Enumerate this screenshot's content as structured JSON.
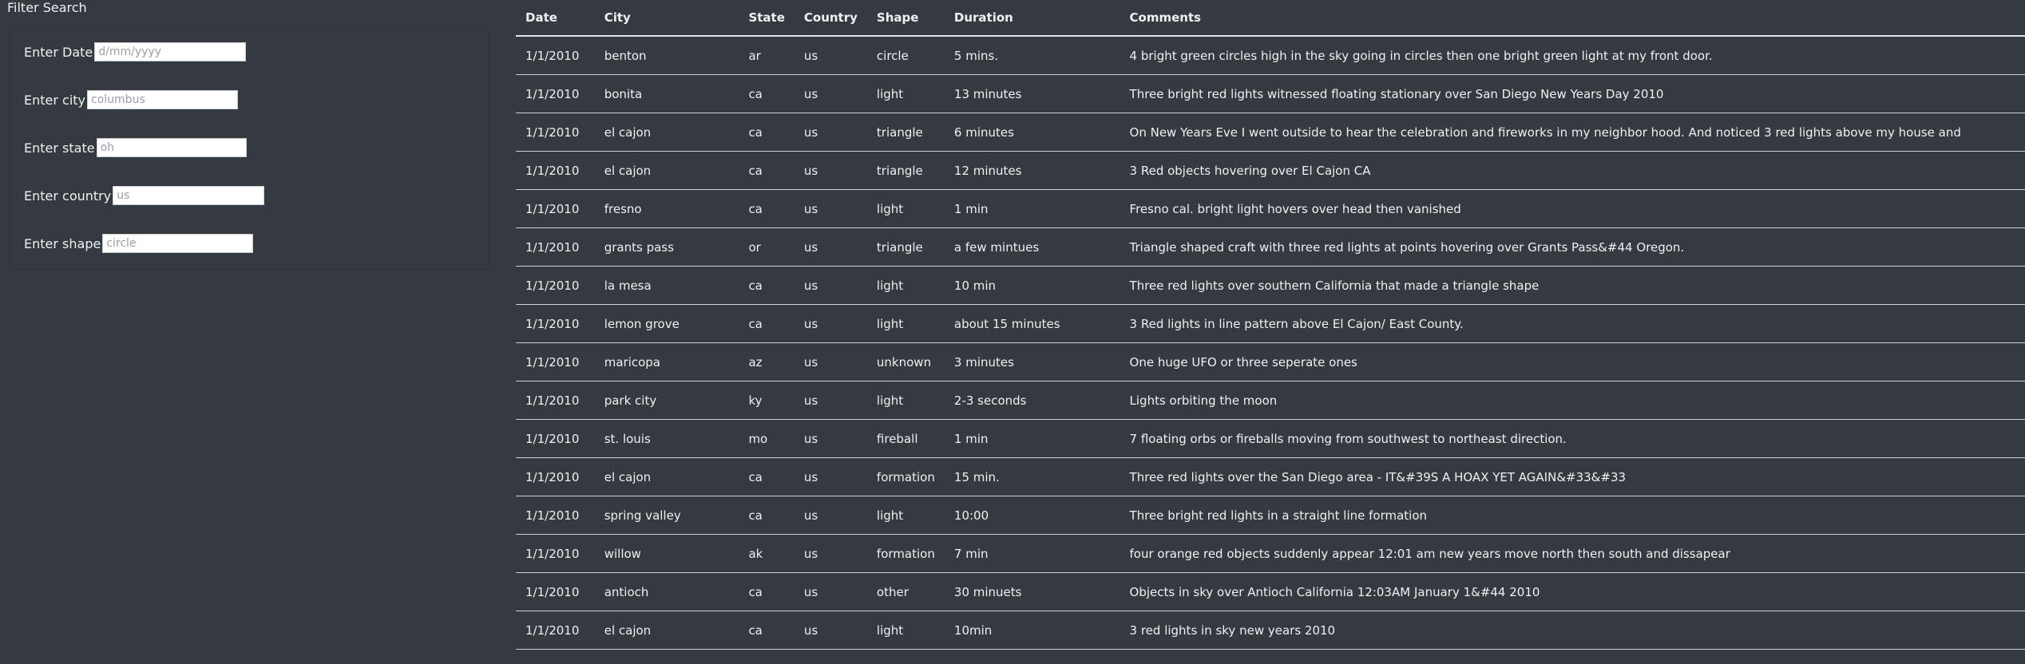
{
  "filter": {
    "title": "Filter Search",
    "fields": [
      {
        "label": "Enter Date",
        "placeholder": "d/mm/yyyy",
        "value": ""
      },
      {
        "label": "Enter city",
        "placeholder": "columbus",
        "value": ""
      },
      {
        "label": "Enter state",
        "placeholder": "oh",
        "value": ""
      },
      {
        "label": "Enter country",
        "placeholder": "us",
        "value": ""
      },
      {
        "label": "Enter shape",
        "placeholder": "circle",
        "value": ""
      }
    ]
  },
  "table": {
    "columns": [
      "Date",
      "City",
      "State",
      "Country",
      "Shape",
      "Duration",
      "Comments"
    ],
    "rows": [
      [
        "1/1/2010",
        "benton",
        "ar",
        "us",
        "circle",
        "5 mins.",
        "4 bright green circles high in the sky going in circles then one bright green light at my front door."
      ],
      [
        "1/1/2010",
        "bonita",
        "ca",
        "us",
        "light",
        "13 minutes",
        "Three bright red lights witnessed floating stationary over San Diego New Years Day 2010"
      ],
      [
        "1/1/2010",
        "el cajon",
        "ca",
        "us",
        "triangle",
        "6 minutes",
        "On New Years Eve I went outside to hear the celebration and fireworks in my neighbor hood. And noticed 3 red lights above my house and"
      ],
      [
        "1/1/2010",
        "el cajon",
        "ca",
        "us",
        "triangle",
        "12 minutes",
        "3 Red objects hovering over El Cajon CA"
      ],
      [
        "1/1/2010",
        "fresno",
        "ca",
        "us",
        "light",
        "1 min",
        "Fresno cal. bright light hovers over head then vanished"
      ],
      [
        "1/1/2010",
        "grants pass",
        "or",
        "us",
        "triangle",
        "a few mintues",
        "Triangle shaped craft with three red lights at points hovering over Grants Pass&#44 Oregon."
      ],
      [
        "1/1/2010",
        "la mesa",
        "ca",
        "us",
        "light",
        "10 min",
        "Three red lights over southern California that made a triangle shape"
      ],
      [
        "1/1/2010",
        "lemon grove",
        "ca",
        "us",
        "light",
        "about 15 minutes",
        "3 Red lights in line pattern above El Cajon/ East County."
      ],
      [
        "1/1/2010",
        "maricopa",
        "az",
        "us",
        "unknown",
        "3 minutes",
        "One huge UFO or three seperate ones"
      ],
      [
        "1/1/2010",
        "park city",
        "ky",
        "us",
        "light",
        "2-3 seconds",
        "Lights orbiting the moon"
      ],
      [
        "1/1/2010",
        "st. louis",
        "mo",
        "us",
        "fireball",
        "1 min",
        "7 floating orbs or fireballs moving from southwest to northeast direction."
      ],
      [
        "1/1/2010",
        "el cajon",
        "ca",
        "us",
        "formation",
        "15 min.",
        "Three red lights over the San Diego area - IT&#39S A HOAX YET AGAIN&#33&#33"
      ],
      [
        "1/1/2010",
        "spring valley",
        "ca",
        "us",
        "light",
        "10:00",
        "Three bright red lights in a straight line formation"
      ],
      [
        "1/1/2010",
        "willow",
        "ak",
        "us",
        "formation",
        "7 min",
        "four orange red objects suddenly appear 12:01 am new years move north then south and dissapear"
      ],
      [
        "1/1/2010",
        "antioch",
        "ca",
        "us",
        "other",
        "30 minuets",
        "Objects in sky over Antioch California 12:03AM January 1&#44 2010"
      ],
      [
        "1/1/2010",
        "el cajon",
        "ca",
        "us",
        "light",
        "10min",
        "3 red lights in sky new years 2010"
      ]
    ]
  }
}
